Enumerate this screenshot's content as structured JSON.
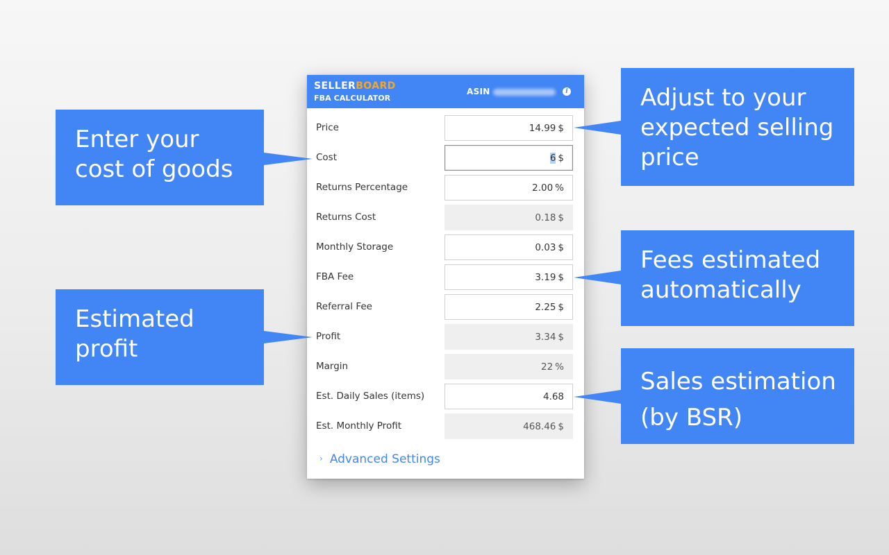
{
  "panel": {
    "brand_part1": "SELLER",
    "brand_part2": "BOARD",
    "subtitle": "FBA CALCULATOR",
    "asin_label": "ASIN",
    "info_icon": "info-icon",
    "colors": {
      "header": "#4285f4",
      "brand_accent": "#f5a623",
      "readonly_bg": "#efefef"
    },
    "rows": [
      {
        "label": "Price",
        "value": "14.99",
        "unit": "$",
        "editable": true
      },
      {
        "label": "Cost",
        "value": "6",
        "unit": "$",
        "editable": true,
        "focused": true
      },
      {
        "label": "Returns Percentage",
        "value": "2.00",
        "unit": "%",
        "editable": true
      },
      {
        "label": "Returns Cost",
        "value": "0.18",
        "unit": "$",
        "editable": false
      },
      {
        "label": "Monthly Storage",
        "value": "0.03",
        "unit": "$",
        "editable": true
      },
      {
        "label": "FBA Fee",
        "value": "3.19",
        "unit": "$",
        "editable": true
      },
      {
        "label": "Referral Fee",
        "value": "2.25",
        "unit": "$",
        "editable": true
      },
      {
        "label": "Profit",
        "value": "3.34",
        "unit": "$",
        "editable": false
      },
      {
        "label": "Margin",
        "value": "22",
        "unit": "%",
        "editable": false
      },
      {
        "label": "Est. Daily Sales (items)",
        "value": "4.68",
        "unit": "",
        "editable": true
      },
      {
        "label": "Est. Monthly Profit",
        "value": "468.46",
        "unit": "$",
        "editable": false
      }
    ],
    "advanced_chevron": "›",
    "advanced_label": "Advanced Settings"
  },
  "callouts": {
    "cost": [
      "Enter your",
      "cost of goods"
    ],
    "price": [
      "Adjust to your",
      "expected selling",
      "price"
    ],
    "fees": [
      "Fees estimated",
      "automatically"
    ],
    "profit": [
      "Estimated",
      "profit"
    ],
    "sales": [
      "Sales estimation",
      "(by BSR)"
    ]
  }
}
